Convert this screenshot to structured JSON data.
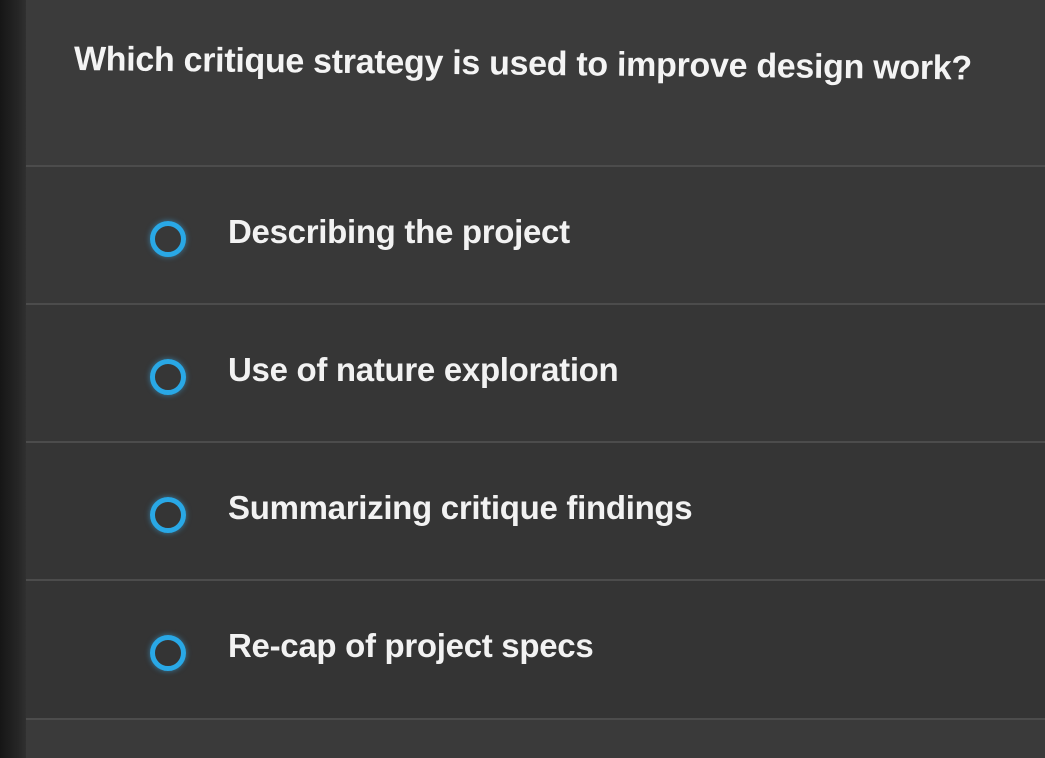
{
  "question": {
    "text": "Which critique strategy is used to improve design work?"
  },
  "options": [
    {
      "label": "Describing the project",
      "selected": false
    },
    {
      "label": "Use of nature exploration",
      "selected": false
    },
    {
      "label": "Summarizing critique findings",
      "selected": false
    },
    {
      "label": "Re-cap of project specs",
      "selected": false
    }
  ],
  "colors": {
    "accent": "#29a8e6",
    "background": "#3a3a3a",
    "text": "#f2f2f2"
  },
  "icons": {
    "radio": "radio-unchecked-icon"
  }
}
